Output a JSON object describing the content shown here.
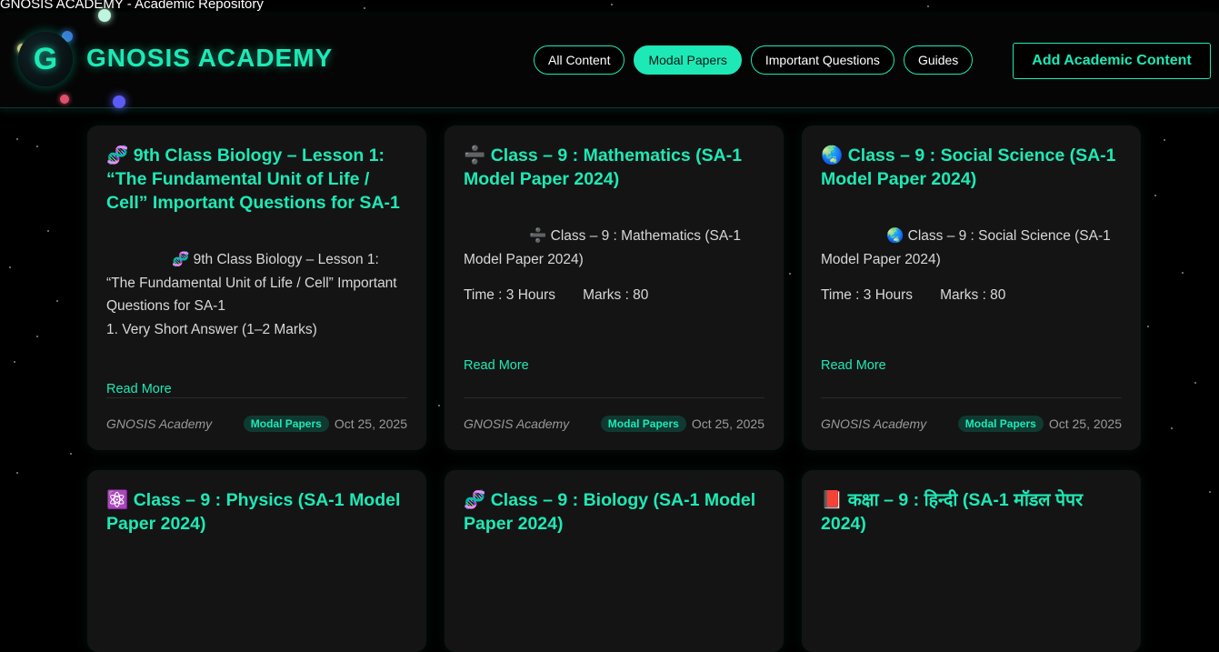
{
  "window": {
    "title": "GNOSIS ACADEMY - Academic Repository"
  },
  "brand": {
    "logo_letter": "G",
    "name": "GNOSIS ACADEMY"
  },
  "nav": [
    {
      "label": "All Content"
    },
    {
      "label": "Modal Papers"
    },
    {
      "label": "Important Questions"
    },
    {
      "label": "Guides"
    }
  ],
  "add_button": {
    "label": "Add Academic Content"
  },
  "colors": {
    "accent": "#1de9b6",
    "background": "#000000",
    "card": "#141414"
  },
  "cards": [
    {
      "icon": "🧬",
      "title": "9th Class Biology – Lesson 1: “The Fundamental Unit of Life / Cell” Important Questions for SA-1",
      "excerpt_icon": "🧬",
      "excerpt": "9th Class Biology – Lesson 1: “The Fundamental Unit of Life / Cell” Important Questions for SA-1",
      "excerpt_extra": "1. Very Short Answer (1–2 Marks)",
      "time": "",
      "marks": "",
      "read_more": "Read More",
      "author": "GNOSIS Academy",
      "badge": "Modal Papers",
      "date": "Oct 25, 2025"
    },
    {
      "icon": "➗",
      "title": "Class – 9 : Mathematics (SA-1 Model Paper 2024)",
      "excerpt_icon": "➗",
      "excerpt": "Class – 9 : Mathematics (SA-1 Model Paper 2024)",
      "excerpt_extra": "",
      "time": "Time : 3 Hours",
      "marks": "Marks : 80",
      "read_more": "Read More",
      "author": "GNOSIS Academy",
      "badge": "Modal Papers",
      "date": "Oct 25, 2025"
    },
    {
      "icon": "🌏",
      "title": "Class – 9 : Social Science (SA-1 Model Paper 2024)",
      "excerpt_icon": "🌏",
      "excerpt": "Class – 9 : Social Science (SA-1 Model Paper 2024)",
      "excerpt_extra": "",
      "time": "Time : 3 Hours",
      "marks": "Marks : 80",
      "read_more": "Read More",
      "author": "GNOSIS Academy",
      "badge": "Modal Papers",
      "date": "Oct 25, 2025"
    },
    {
      "icon": "⚛️",
      "title": "Class – 9 : Physics (SA-1 Model Paper 2024)"
    },
    {
      "icon": "🧬",
      "title": "Class – 9 : Biology (SA-1 Model Paper 2024)"
    },
    {
      "icon": "📕",
      "title": "कक्षा – 9 : हिन्दी (SA-1 मॉडल पेपर 2024)"
    }
  ]
}
